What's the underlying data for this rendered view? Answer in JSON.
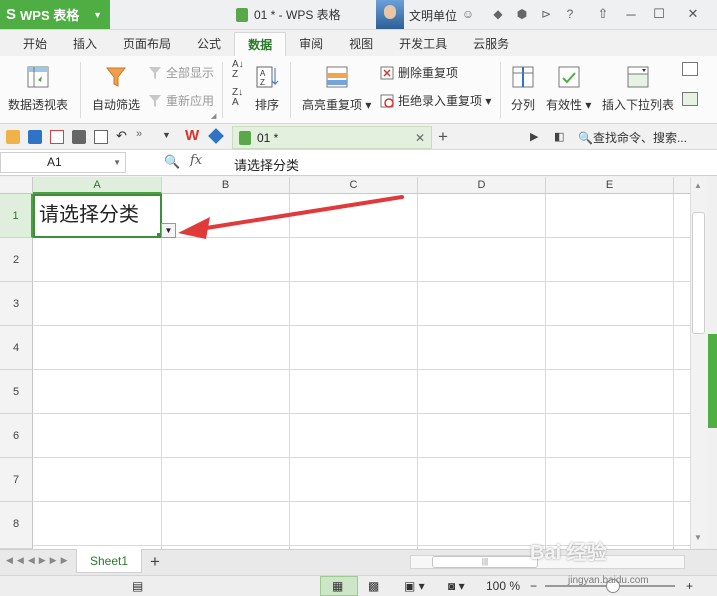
{
  "app": {
    "name": "WPS 表格",
    "logo": "S",
    "brand_color": "#4fae43"
  },
  "window": {
    "doc_title": "01 * - WPS 表格",
    "username": "文明单位"
  },
  "tabs": [
    {
      "label": "开始"
    },
    {
      "label": "插入"
    },
    {
      "label": "页面布局"
    },
    {
      "label": "公式"
    },
    {
      "label": "数据",
      "active": true
    },
    {
      "label": "审阅"
    },
    {
      "label": "视图"
    },
    {
      "label": "开发工具"
    },
    {
      "label": "云服务"
    }
  ],
  "ribbon": {
    "pivot": "数据透视表",
    "autofilter": "自动筛选",
    "show_all": "全部显示",
    "reapply": "重新应用",
    "sort": "排序",
    "highlight_dup": "高亮重复项",
    "remove_dup": "删除重复项",
    "reject_dup": "拒绝录入重复项",
    "split": "分列",
    "validity": "有效性",
    "insert_dropdown": "插入下拉列表"
  },
  "doc_tab": {
    "label": "01 *"
  },
  "search_cmd": "查找命令、搜索...",
  "formula_bar": {
    "name_box": "A1",
    "fx": "fx",
    "content": "请选择分类"
  },
  "columns": [
    "A",
    "B",
    "C",
    "D",
    "E"
  ],
  "rows": [
    "1",
    "2",
    "3",
    "4",
    "5",
    "6",
    "7",
    "8"
  ],
  "cells": {
    "A1": "请选择分类"
  },
  "sheet_tab": "Sheet1",
  "status": {
    "zoom": "100 %",
    "minus": "−",
    "plus": "+"
  },
  "watermark": {
    "main": "Bai 经验",
    "sub": "jingyan.baidu.com"
  }
}
